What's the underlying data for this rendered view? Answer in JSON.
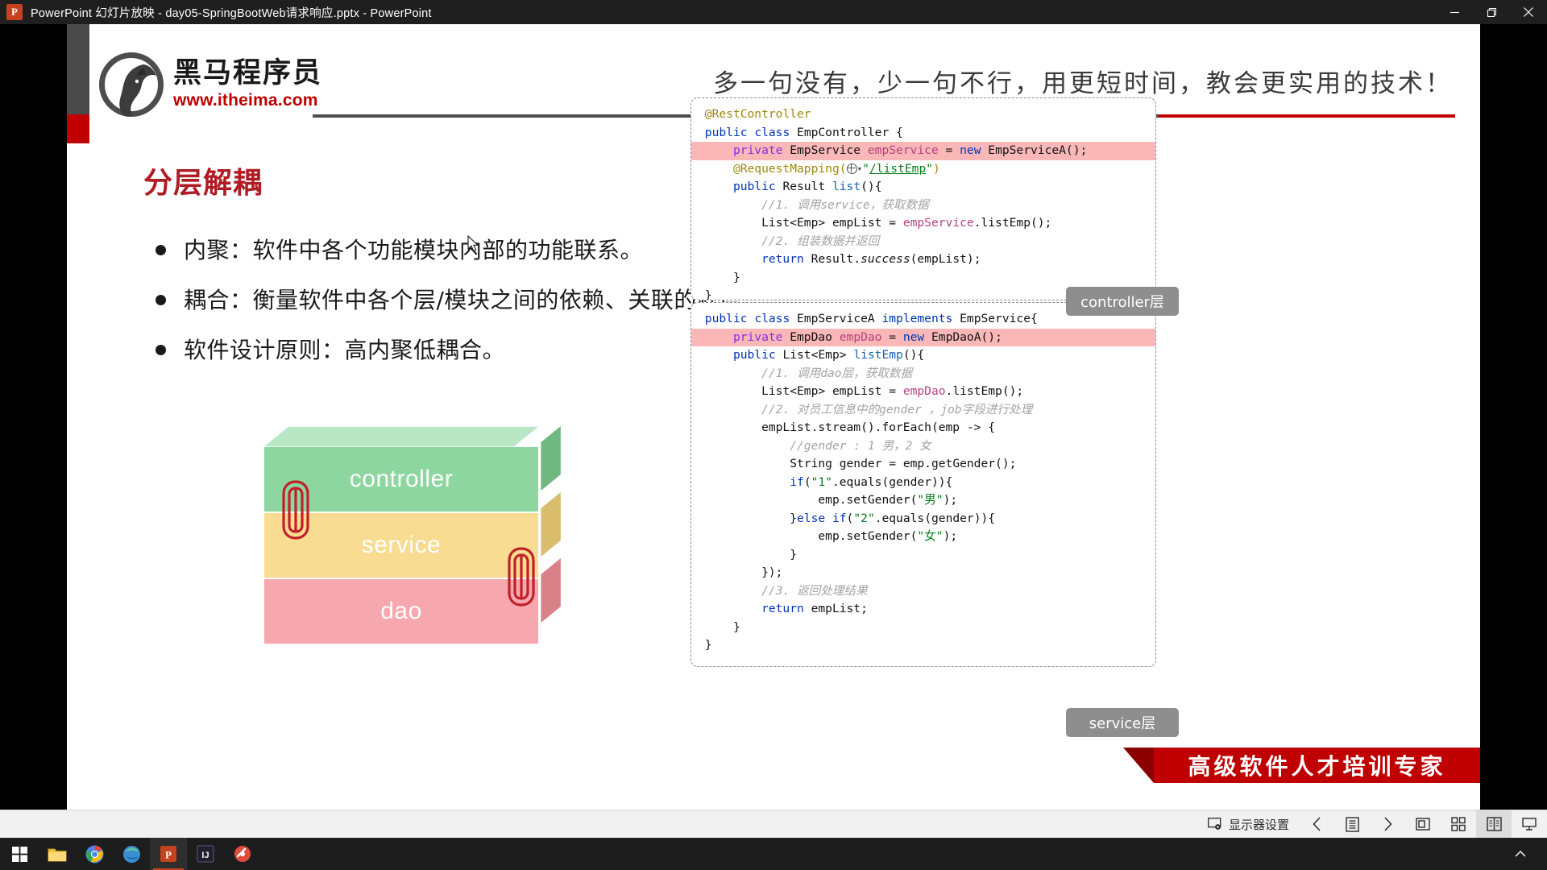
{
  "titlebar": {
    "app_icon": "powerpoint-icon",
    "title": "PowerPoint 幻灯片放映  -  day05-SpringBootWeb请求响应.pptx - PowerPoint",
    "minimize_label": "最小化",
    "restore_label": "向下还原",
    "close_label": "关闭"
  },
  "slide": {
    "logo": {
      "cn_name": "黑马程序员",
      "url": "www.itheima.com"
    },
    "tagline": "多一句没有，少一句不行，用更短时间，教会更实用的技术！",
    "title": "分层解耦",
    "bullets": [
      "内聚：软件中各个功能模块内部的功能联系。",
      "耦合：衡量软件中各个层/模块之间的依赖、关联的程度。",
      "软件设计原则：高内聚低耦合。"
    ],
    "stack_layers": [
      {
        "label": "controller",
        "color": "#8ed6a0",
        "top_color": "#b9e6c5",
        "side_color": "#6fb882"
      },
      {
        "label": "service",
        "color": "#f7dc92",
        "top_color": "#fbecc2",
        "side_color": "#d9bd6d"
      },
      {
        "label": "dao",
        "color": "#f7a8ae",
        "top_color": "#fbc9cd",
        "side_color": "#d98189"
      }
    ],
    "tags": {
      "controller": "controller层",
      "service": "service层"
    },
    "ribbon": "高级软件人才培训专家",
    "code_controller": [
      {
        "indent": 0,
        "hl": false,
        "tokens": [
          {
            "t": "@RestController",
            "c": "ann"
          }
        ]
      },
      {
        "indent": 0,
        "hl": false,
        "tokens": [
          {
            "t": "public ",
            "c": "kw"
          },
          {
            "t": "class ",
            "c": "kw"
          },
          {
            "t": "EmpController {",
            "c": ""
          }
        ]
      },
      {
        "indent": 1,
        "hl": true,
        "tokens": [
          {
            "t": "private ",
            "c": "kwp"
          },
          {
            "t": "EmpService ",
            "c": ""
          },
          {
            "t": "empService ",
            "c": "fld"
          },
          {
            "t": "= ",
            "c": ""
          },
          {
            "t": "new ",
            "c": "kw"
          },
          {
            "t": "EmpServiceA();",
            "c": ""
          }
        ]
      },
      {
        "indent": 1,
        "hl": false,
        "tokens": [
          {
            "t": "@RequestMapping(",
            "c": "ann"
          },
          {
            "t": "GLOBE",
            "c": "icon"
          },
          {
            "t": "\"",
            "c": "strv"
          },
          {
            "t": "/listEmp",
            "c": "link"
          },
          {
            "t": "\"",
            "c": "strv"
          },
          {
            "t": ")",
            "c": "ann"
          }
        ]
      },
      {
        "indent": 1,
        "hl": false,
        "tokens": [
          {
            "t": "public ",
            "c": "kw"
          },
          {
            "t": "Result ",
            "c": ""
          },
          {
            "t": "list",
            "c": "meth"
          },
          {
            "t": "(){",
            "c": ""
          }
        ]
      },
      {
        "indent": 2,
        "hl": false,
        "tokens": [
          {
            "t": "//1. 调用service，获取数据",
            "c": "cmt"
          }
        ]
      },
      {
        "indent": 2,
        "hl": false,
        "tokens": [
          {
            "t": "List<Emp> empList = ",
            "c": ""
          },
          {
            "t": "empService",
            "c": "fld"
          },
          {
            "t": ".listEmp();",
            "c": ""
          }
        ]
      },
      {
        "indent": 2,
        "hl": false,
        "tokens": [
          {
            "t": "//2. 组装数据并返回",
            "c": "cmt"
          }
        ]
      },
      {
        "indent": 2,
        "hl": false,
        "tokens": [
          {
            "t": "return ",
            "c": "kw"
          },
          {
            "t": "Result.",
            "c": ""
          },
          {
            "t": "success",
            "c": "ital"
          },
          {
            "t": "(empList);",
            "c": ""
          }
        ]
      },
      {
        "indent": 1,
        "hl": false,
        "tokens": [
          {
            "t": "}",
            "c": ""
          }
        ]
      },
      {
        "indent": 0,
        "hl": false,
        "tokens": [
          {
            "t": "}",
            "c": ""
          }
        ]
      }
    ],
    "code_service": [
      {
        "indent": 0,
        "hl": false,
        "tokens": [
          {
            "t": "public ",
            "c": "kw"
          },
          {
            "t": "class ",
            "c": "kw"
          },
          {
            "t": "EmpServiceA ",
            "c": ""
          },
          {
            "t": "implements ",
            "c": "kw"
          },
          {
            "t": "EmpService{",
            "c": ""
          }
        ]
      },
      {
        "indent": 1,
        "hl": true,
        "tokens": [
          {
            "t": "private ",
            "c": "kwp"
          },
          {
            "t": "EmpDao ",
            "c": ""
          },
          {
            "t": "empDao ",
            "c": "fld"
          },
          {
            "t": "= ",
            "c": ""
          },
          {
            "t": "new ",
            "c": "kw"
          },
          {
            "t": "EmpDaoA();",
            "c": ""
          }
        ]
      },
      {
        "indent": 1,
        "hl": false,
        "tokens": [
          {
            "t": "public ",
            "c": "kw"
          },
          {
            "t": "List<Emp> ",
            "c": ""
          },
          {
            "t": "listEmp",
            "c": "meth"
          },
          {
            "t": "(){",
            "c": ""
          }
        ]
      },
      {
        "indent": 2,
        "hl": false,
        "tokens": [
          {
            "t": "//1. 调用dao层，获取数据",
            "c": "cmt"
          }
        ]
      },
      {
        "indent": 2,
        "hl": false,
        "tokens": [
          {
            "t": "List<Emp> empList = ",
            "c": ""
          },
          {
            "t": "empDao",
            "c": "fld"
          },
          {
            "t": ".listEmp();",
            "c": ""
          }
        ]
      },
      {
        "indent": 2,
        "hl": false,
        "tokens": [
          {
            "t": "//2. 对员工信息中的gender ，job字段进行处理",
            "c": "cmt"
          }
        ]
      },
      {
        "indent": 2,
        "hl": false,
        "tokens": [
          {
            "t": "empList.stream().forEach(emp -> {",
            "c": ""
          }
        ]
      },
      {
        "indent": 3,
        "hl": false,
        "tokens": [
          {
            "t": "//gender : 1 男，2 女",
            "c": "cmt"
          }
        ]
      },
      {
        "indent": 3,
        "hl": false,
        "tokens": [
          {
            "t": "String gender = emp.getGender();",
            "c": ""
          }
        ]
      },
      {
        "indent": 3,
        "hl": false,
        "tokens": [
          {
            "t": "if",
            "c": "kw"
          },
          {
            "t": "(",
            "c": ""
          },
          {
            "t": "\"1\"",
            "c": "strv"
          },
          {
            "t": ".equals(gender)){",
            "c": ""
          }
        ]
      },
      {
        "indent": 4,
        "hl": false,
        "tokens": [
          {
            "t": "emp.setGender(",
            "c": ""
          },
          {
            "t": "\"男\"",
            "c": "strv"
          },
          {
            "t": ");",
            "c": ""
          }
        ]
      },
      {
        "indent": 3,
        "hl": false,
        "tokens": [
          {
            "t": "}",
            "c": ""
          },
          {
            "t": "else if",
            "c": "kw"
          },
          {
            "t": "(",
            "c": ""
          },
          {
            "t": "\"2\"",
            "c": "strv"
          },
          {
            "t": ".equals(gender)){",
            "c": ""
          }
        ]
      },
      {
        "indent": 4,
        "hl": false,
        "tokens": [
          {
            "t": "emp.setGender(",
            "c": ""
          },
          {
            "t": "\"女\"",
            "c": "strv"
          },
          {
            "t": ");",
            "c": ""
          }
        ]
      },
      {
        "indent": 3,
        "hl": false,
        "tokens": [
          {
            "t": "}",
            "c": ""
          }
        ]
      },
      {
        "indent": 2,
        "hl": false,
        "tokens": [
          {
            "t": "});",
            "c": ""
          }
        ]
      },
      {
        "indent": 2,
        "hl": false,
        "tokens": [
          {
            "t": "//3. 返回处理结果",
            "c": "cmt"
          }
        ]
      },
      {
        "indent": 2,
        "hl": false,
        "tokens": [
          {
            "t": "return ",
            "c": "kw"
          },
          {
            "t": "empList;",
            "c": ""
          }
        ]
      },
      {
        "indent": 1,
        "hl": false,
        "tokens": [
          {
            "t": "}",
            "c": ""
          }
        ]
      },
      {
        "indent": 0,
        "hl": false,
        "tokens": [
          {
            "t": "}",
            "c": ""
          }
        ]
      }
    ]
  },
  "presenter_bar": {
    "display_settings": "显示器设置",
    "prev_label": "上一张",
    "menu_label": "幻灯片放映选项",
    "next_label": "下一张",
    "pointer_label": "指针选项",
    "grid_label": "查看所有幻灯片",
    "zoom_label": "放大到幻灯片",
    "present_label": "演示者视图"
  },
  "taskbar": {
    "start_label": "开始",
    "apps": [
      "file-explorer-icon",
      "chrome-icon",
      "edge-icon",
      "powerpoint-icon",
      "idea-icon",
      "browser-icon"
    ],
    "show_hidden_label": "显示隐藏的图标"
  },
  "colors": {
    "brand_red": "#c00000",
    "title_red": "#b01c24",
    "highlight_pink": "#f9b7b7",
    "taskbar_dark": "#1d1d1d"
  }
}
